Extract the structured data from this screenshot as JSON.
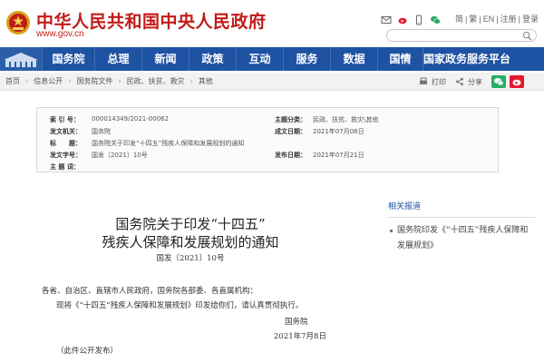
{
  "header": {
    "site_title": "中华人民共和国中央人民政府",
    "site_url": "www.gov.cn",
    "top_links": [
      "简",
      "繁",
      "EN",
      "注册",
      "登录"
    ],
    "search_placeholder": ""
  },
  "nav": {
    "items": [
      "国务院",
      "总理",
      "新闻",
      "政策",
      "互动",
      "服务",
      "数据",
      "国情",
      "国家政务服务平台"
    ]
  },
  "breadcrumb": {
    "items": [
      "首页",
      "信息公开",
      "国务院文件",
      "民政、扶贫、救灾",
      "其他"
    ]
  },
  "toolbar": {
    "print_label": "打印",
    "share_label": "分享"
  },
  "meta": {
    "index_no_label": "索 引 号：",
    "index_no": "000014349/2021-00062",
    "category_label": "主题分类：",
    "category": "民政、扶贫、救灾\\其他",
    "issuer_label": "发文机关：",
    "issuer": "国务院",
    "written_date_label": "成文日期：",
    "written_date": "2021年07月08日",
    "title_label": "标　　题：",
    "title": "国务院关于印发“十四五”残疾人保障和发展规划的通知",
    "doc_no_label": "发文字号：",
    "doc_no": "国发〔2021〕10号",
    "publish_date_label": "发布日期：",
    "publish_date": "2021年07月21日",
    "keywords_label": "主 题 词："
  },
  "article": {
    "title_line1": "国务院关于印发“十四五”",
    "title_line2": "残疾人保障和发展规划的通知",
    "doc_number": "国发〔2021〕10号",
    "recipients": "各省、自治区、直辖市人民政府，国务院各部委、各直属机构：",
    "body": "现将《“十四五”残疾人保障和发展规划》印发给你们，请认真贯彻执行。",
    "signature": "国务院",
    "date": "2021年7月8日",
    "public_note": "（此件公开发布）"
  },
  "sidebar": {
    "related_title": "相关报道",
    "related_items": [
      "国务院印发《“十四五”残疾人保障和发展规划》"
    ]
  },
  "colors": {
    "brand_red": "#c21b17",
    "nav_blue": "#1e52a3",
    "link_blue": "#1e52a3"
  }
}
